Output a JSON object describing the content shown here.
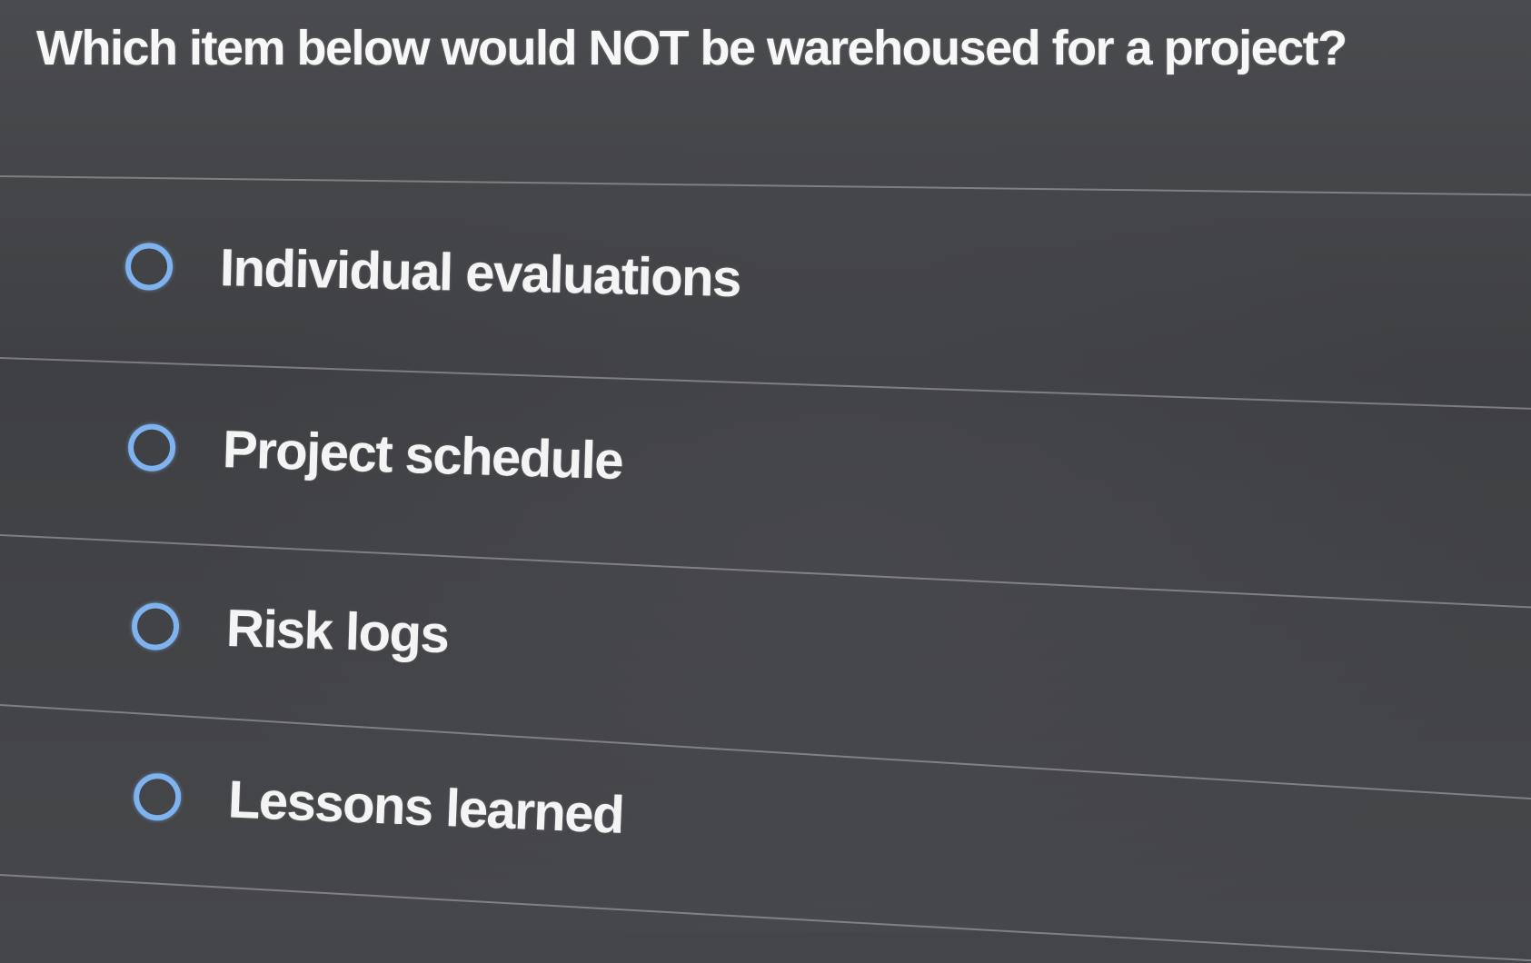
{
  "question": {
    "text": "Which item below would NOT be warehoused for a project?"
  },
  "options": [
    {
      "label": "Individual evaluations",
      "selected": false
    },
    {
      "label": "Project schedule",
      "selected": false
    },
    {
      "label": "Risk logs",
      "selected": false
    },
    {
      "label": "Lessons learned",
      "selected": false
    }
  ],
  "colors": {
    "background": "#444548",
    "radio_ring": "#7fb3f0",
    "text": "#f4f4f4"
  }
}
